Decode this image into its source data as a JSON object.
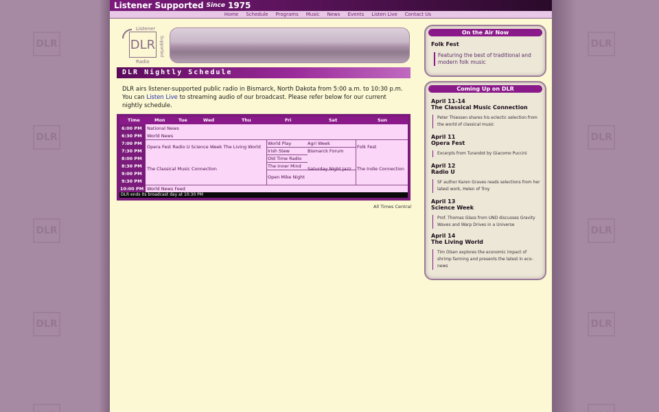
{
  "site": {
    "tagline": "Listener Supported",
    "since_word": "Since",
    "since_year": "1975"
  },
  "nav": [
    "Home",
    "Schedule",
    "Programs",
    "Music",
    "News",
    "Events",
    "Listen Live",
    "Contact Us"
  ],
  "logo": {
    "top": "Listener",
    "letters": "DLR",
    "bottom": "Radio",
    "side": "Supported"
  },
  "background_logo": "DLR",
  "section_title": "DLR Nightly Schedule",
  "intro": {
    "text_before": "DLR airs listener-supported public radio in Bismarck, North Dakota from 5:00 a.m. to 10:30 p.m. You can ",
    "link": "Listen Live",
    "text_after": " to streaming audio of our broadcast. Please refer below for our current nightly schedule."
  },
  "schedule": {
    "headers": [
      "Time",
      "Mon",
      "Tue",
      "Wed",
      "Thu",
      "Fri",
      "Sat",
      "Sun"
    ],
    "times": [
      "6:00 PM",
      "6:30 PM",
      "7:00 PM",
      "7:30 PM",
      "8:00 PM",
      "8:30 PM",
      "9:00 PM",
      "9:30 PM",
      "10:00 PM"
    ],
    "cells": {
      "national_news": "National News",
      "world_news": "World News",
      "weekday_7pm": "Opera Fest  Radio U  Science Week  The Living World",
      "classical": "The Classical Music Connection",
      "world_play": "World Play",
      "agri_week": "Agri Week",
      "irish_stew": "Irish Stew",
      "bismarck_forum": "Bismarck Forum",
      "old_time_radio": "Old Time Radio",
      "inner_mind": "The Inner Mind",
      "saturday_jazz": "Saturday Night Jazz",
      "open_mike": "Open Mike Night",
      "folk_fest": "Folk Fest",
      "indie": "The Indie Connection",
      "world_news_feed": "World News Feed"
    },
    "footer": "DLR ends its broadcast day at 10:30 PM"
  },
  "all_times": "All Times Central",
  "on_air": {
    "heading": "On the Air Now",
    "title": "Folk Fest",
    "description": "Featuring the best of traditional and modern folk music"
  },
  "coming_up": {
    "heading": "Coming Up on DLR",
    "items": [
      {
        "date": "April 11-14",
        "name": "The Classical Music Connection",
        "desc": "Peter Thiessen shares his eclectic selection from the world of classical music"
      },
      {
        "date": "April 11",
        "name": "Opera Fest",
        "desc": "Excerpts from Turandot by Giacomo Puccini"
      },
      {
        "date": "April 12",
        "name": "Radio U",
        "desc": "SF author Karen Graves reads selections from her latest work, Helen of Troy"
      },
      {
        "date": "April 13",
        "name": "Science Week",
        "desc": "Prof. Thomas Glass from UND discusses Gravity Waves and Warp Drives in a Universe"
      },
      {
        "date": "April 14",
        "name": "The Living World",
        "desc": "Tim Olsen explores the economic impact of shrimp farming and presents the latest in eco-news"
      }
    ]
  },
  "colors": {
    "background": "#a68aa3",
    "page": "#fbf8d3",
    "accent": "#8a1a8a",
    "schedule_bg": "#fbd6f8"
  }
}
